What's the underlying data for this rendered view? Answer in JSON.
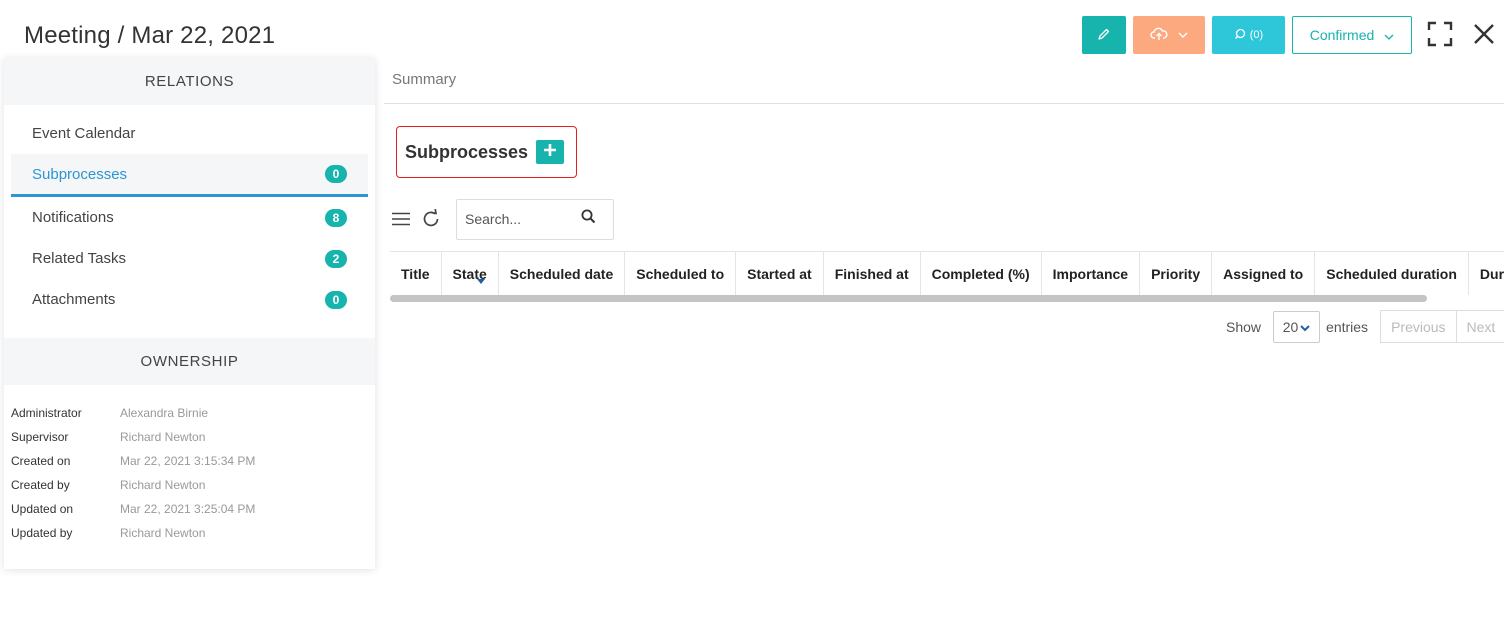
{
  "header": {
    "title": "Meeting / Mar 22, 2021",
    "comment_label": "(0)",
    "status_label": "Confirmed"
  },
  "icons": {
    "edit": "pencil-icon",
    "cloud": "cloud-upload-icon",
    "comment": "comment-icon",
    "expand": "fullscreen-icon",
    "close": "close-icon"
  },
  "colors": {
    "primary": "#17b3ad",
    "orange": "#fca97f",
    "cyan": "#2ec7da",
    "link": "#2e94d4",
    "highlight": "#e02020"
  },
  "sidebar": {
    "relations_title": "RELATIONS",
    "items": [
      {
        "label": "Event Calendar",
        "count": ""
      },
      {
        "label": "Subprocesses",
        "count": "0"
      },
      {
        "label": "Notifications",
        "count": "8"
      },
      {
        "label": "Related Tasks",
        "count": "2"
      },
      {
        "label": "Attachments",
        "count": "0"
      }
    ],
    "ownership_title": "OWNERSHIP",
    "ownership": [
      {
        "label": "Administrator",
        "value": "Alexandra Birnie"
      },
      {
        "label": "Supervisor",
        "value": "Richard Newton"
      },
      {
        "label": "Created on",
        "value": "Mar 22, 2021 3:15:34 PM"
      },
      {
        "label": "Created by",
        "value": "Richard Newton"
      },
      {
        "label": "Updated on",
        "value": "Mar 22, 2021 3:25:04 PM"
      },
      {
        "label": "Updated by",
        "value": "Richard Newton"
      }
    ]
  },
  "main": {
    "summary_tab": "Summary",
    "section_title": "Subprocesses",
    "search_placeholder": "Search...",
    "columns": [
      "Title",
      "State",
      "Scheduled date",
      "Scheduled to",
      "Started at",
      "Finished at",
      "Completed (%)",
      "Importance",
      "Priority",
      "Assigned to",
      "Scheduled duration",
      "Dura"
    ],
    "pager": {
      "show_label": "Show",
      "page_size": "20",
      "entries_label": "entries",
      "previous_label": "Previous",
      "next_label": "Next"
    }
  }
}
